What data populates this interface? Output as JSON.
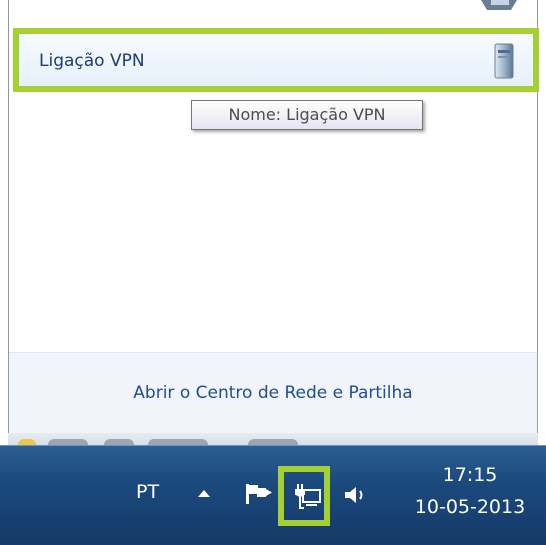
{
  "flyout": {
    "vpn_connection": {
      "name": "Ligação VPN"
    },
    "tooltip": "Nome: Ligação VPN",
    "footer_link": "Abrir o Centro de Rede e Partilha"
  },
  "taskbar": {
    "language": "PT",
    "clock": {
      "time": "17:15",
      "date": "10-05-2013"
    },
    "tray_icons": [
      "show-hidden-icons-arrow",
      "action-center-flag-icon",
      "network-icon",
      "volume-icon"
    ]
  },
  "colors": {
    "highlight": "#a5d033",
    "link": "#1e4f8f",
    "taskbar": "#1c4a7e"
  }
}
